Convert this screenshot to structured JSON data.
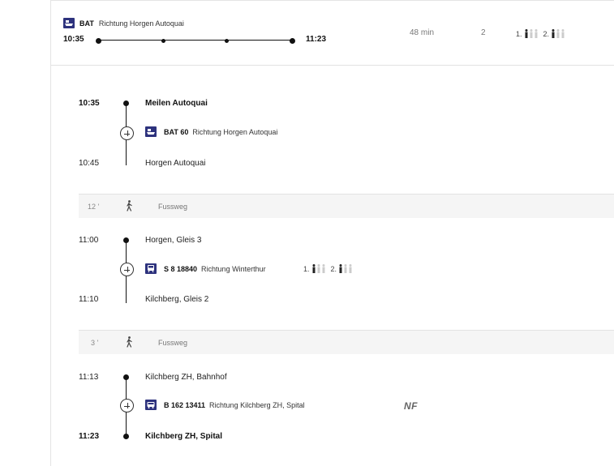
{
  "summary": {
    "product": "BAT",
    "direction": "Richtung Horgen Autoquai",
    "departure": "10:35",
    "arrival": "11:23",
    "duration": "48 min",
    "changes": "2",
    "occupancy": [
      {
        "class": "1.",
        "level": 1
      },
      {
        "class": "2.",
        "level": 1
      }
    ]
  },
  "legs": [
    {
      "dep_time": "10:35",
      "dep_stop": "Meilen Autoquai",
      "service": "BAT 60",
      "direction": "Richtung Horgen Autoquai",
      "arr_time": "10:45",
      "arr_stop": "Horgen Autoquai",
      "icon": "boat-icon"
    },
    {
      "dep_time": "11:00",
      "dep_stop": "Horgen, Gleis 3",
      "service": "S 8 18840",
      "direction": "Richtung Winterthur",
      "occupancy": [
        {
          "class": "1.",
          "level": 1
        },
        {
          "class": "2.",
          "level": 1
        }
      ],
      "arr_time": "11:10",
      "arr_stop": "Kilchberg, Gleis 2",
      "icon": "train-icon"
    },
    {
      "dep_time": "11:13",
      "dep_stop": "Kilchberg ZH, Bahnhof",
      "service": "B 162 13411",
      "direction": "Richtung Kilchberg ZH, Spital",
      "attribute": "NF",
      "arr_time": "11:23",
      "arr_stop": "Kilchberg ZH, Spital",
      "icon": "bus-icon"
    }
  ],
  "walks": [
    {
      "duration": "12 '",
      "label": "Fussweg"
    },
    {
      "duration": "3 '",
      "label": "Fussweg"
    }
  ],
  "colors": {
    "accent": "#2d327d",
    "line": "#111111",
    "walk_bg": "#f5f5f5"
  }
}
